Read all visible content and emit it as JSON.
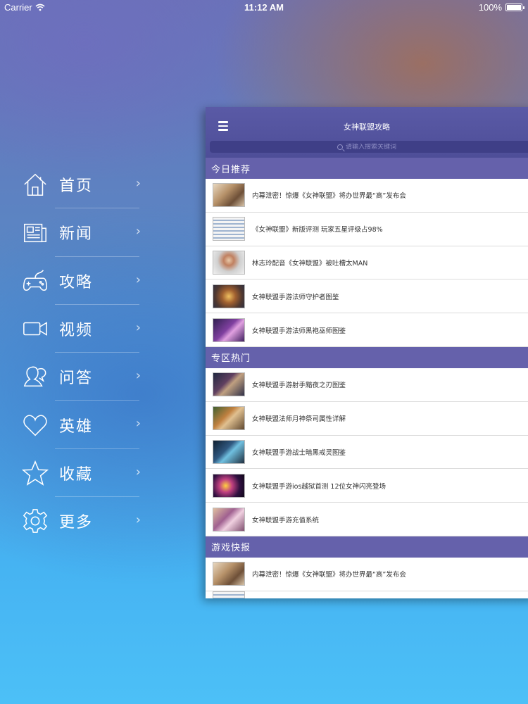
{
  "status_bar": {
    "carrier": "Carrier",
    "time": "11:12 AM",
    "battery": "100%"
  },
  "menu": {
    "items": [
      {
        "label": "首页",
        "icon": "home-icon"
      },
      {
        "label": "新闻",
        "icon": "newspaper-icon"
      },
      {
        "label": "攻略",
        "icon": "gamepad-icon"
      },
      {
        "label": "视频",
        "icon": "video-camera-icon"
      },
      {
        "label": "问答",
        "icon": "user-question-icon"
      },
      {
        "label": "英雄",
        "icon": "heart-icon"
      },
      {
        "label": "收藏",
        "icon": "star-icon"
      },
      {
        "label": "更多",
        "icon": "gear-icon"
      }
    ],
    "chevron": "›"
  },
  "panel": {
    "title": "女神联盟攻略",
    "search_placeholder": "请输入搜索关键词",
    "sections": [
      {
        "title": "今日推荐",
        "items": [
          "内幕泄密！惊爆《女神联盟》将办世界最“高”发布会",
          "《女神联盟》新版评测 玩家五星评级占98%",
          "林志玲配音《女神联盟》被吐槽太MAN",
          "女神联盟手游法师守护者图鉴",
          "女神联盟手游法师黑袍巫师图鉴"
        ]
      },
      {
        "title": "专区热门",
        "items": [
          "女神联盟手游射手黯夜之刃图鉴",
          "女神联盟法师月神祭司属性详解",
          "女神联盟手游战士暗黑戒灵图鉴",
          "女神联盟手游ios越狱首测 12位女神闪亮登场",
          "女神联盟手游充值系统"
        ]
      },
      {
        "title": "游戏快报",
        "items": [
          "内幕泄密！惊爆《女神联盟》将办世界最“高”发布会"
        ]
      }
    ]
  }
}
